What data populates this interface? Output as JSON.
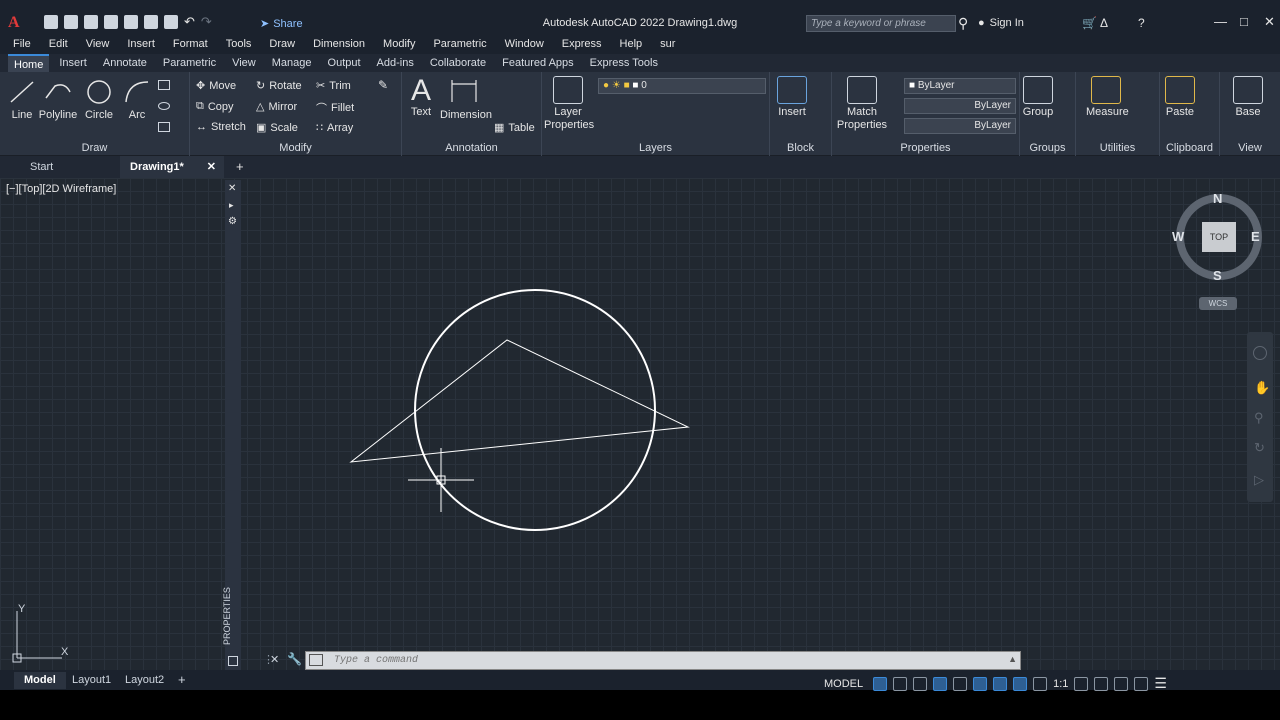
{
  "window": {
    "title": "Autodesk AutoCAD 2022    Drawing1.dwg",
    "share_label": "Share"
  },
  "search": {
    "placeholder": "Type a keyword or phrase"
  },
  "account": {
    "sign_in": "Sign In"
  },
  "menu": [
    "File",
    "Edit",
    "View",
    "Insert",
    "Format",
    "Tools",
    "Draw",
    "Dimension",
    "Modify",
    "Parametric",
    "Window",
    "Express",
    "Help",
    "sur"
  ],
  "ribbon_tabs": [
    "Home",
    "Insert",
    "Annotate",
    "Parametric",
    "View",
    "Manage",
    "Output",
    "Add-ins",
    "Collaborate",
    "Featured Apps",
    "Express Tools"
  ],
  "panels": {
    "draw": {
      "title": "Draw",
      "line": "Line",
      "polyline": "Polyline",
      "circle": "Circle",
      "arc": "Arc"
    },
    "modify": {
      "title": "Modify",
      "move": "Move",
      "rotate": "Rotate",
      "trim": "Trim",
      "copy": "Copy",
      "mirror": "Mirror",
      "fillet": "Fillet",
      "stretch": "Stretch",
      "scale": "Scale",
      "array": "Array"
    },
    "annotation": {
      "title": "Annotation",
      "text": "Text",
      "dimension": "Dimension",
      "table": "Table"
    },
    "layers": {
      "title": "Layers",
      "layer_properties": "Layer Properties",
      "current_layer": "0"
    },
    "block": {
      "title": "Block",
      "insert": "Insert"
    },
    "properties": {
      "title": "Properties",
      "match": "Match Properties",
      "color": "ByLayer",
      "linetype": "ByLayer",
      "lineweight": "ByLayer"
    },
    "groups": {
      "title": "Groups",
      "group": "Group"
    },
    "utilities": {
      "title": "Utilities",
      "measure": "Measure"
    },
    "clipboard": {
      "title": "Clipboard",
      "paste": "Paste"
    },
    "view": {
      "title": "View",
      "base": "Base"
    }
  },
  "doc_tabs": {
    "start": "Start",
    "drawing": "Drawing1*"
  },
  "viewport": {
    "label": "[−][Top][2D Wireframe]"
  },
  "properties_palette": {
    "label": "PROPERTIES"
  },
  "viewcube": {
    "top": "TOP",
    "north": "N",
    "south": "S",
    "east": "E",
    "west": "W",
    "wcs": "WCS"
  },
  "ucs": {
    "x": "X",
    "y": "Y"
  },
  "command": {
    "placeholder": "Type a command"
  },
  "layout_tabs": [
    "Model",
    "Layout1",
    "Layout2"
  ],
  "status": {
    "model": "MODEL",
    "scale": "1:1"
  }
}
